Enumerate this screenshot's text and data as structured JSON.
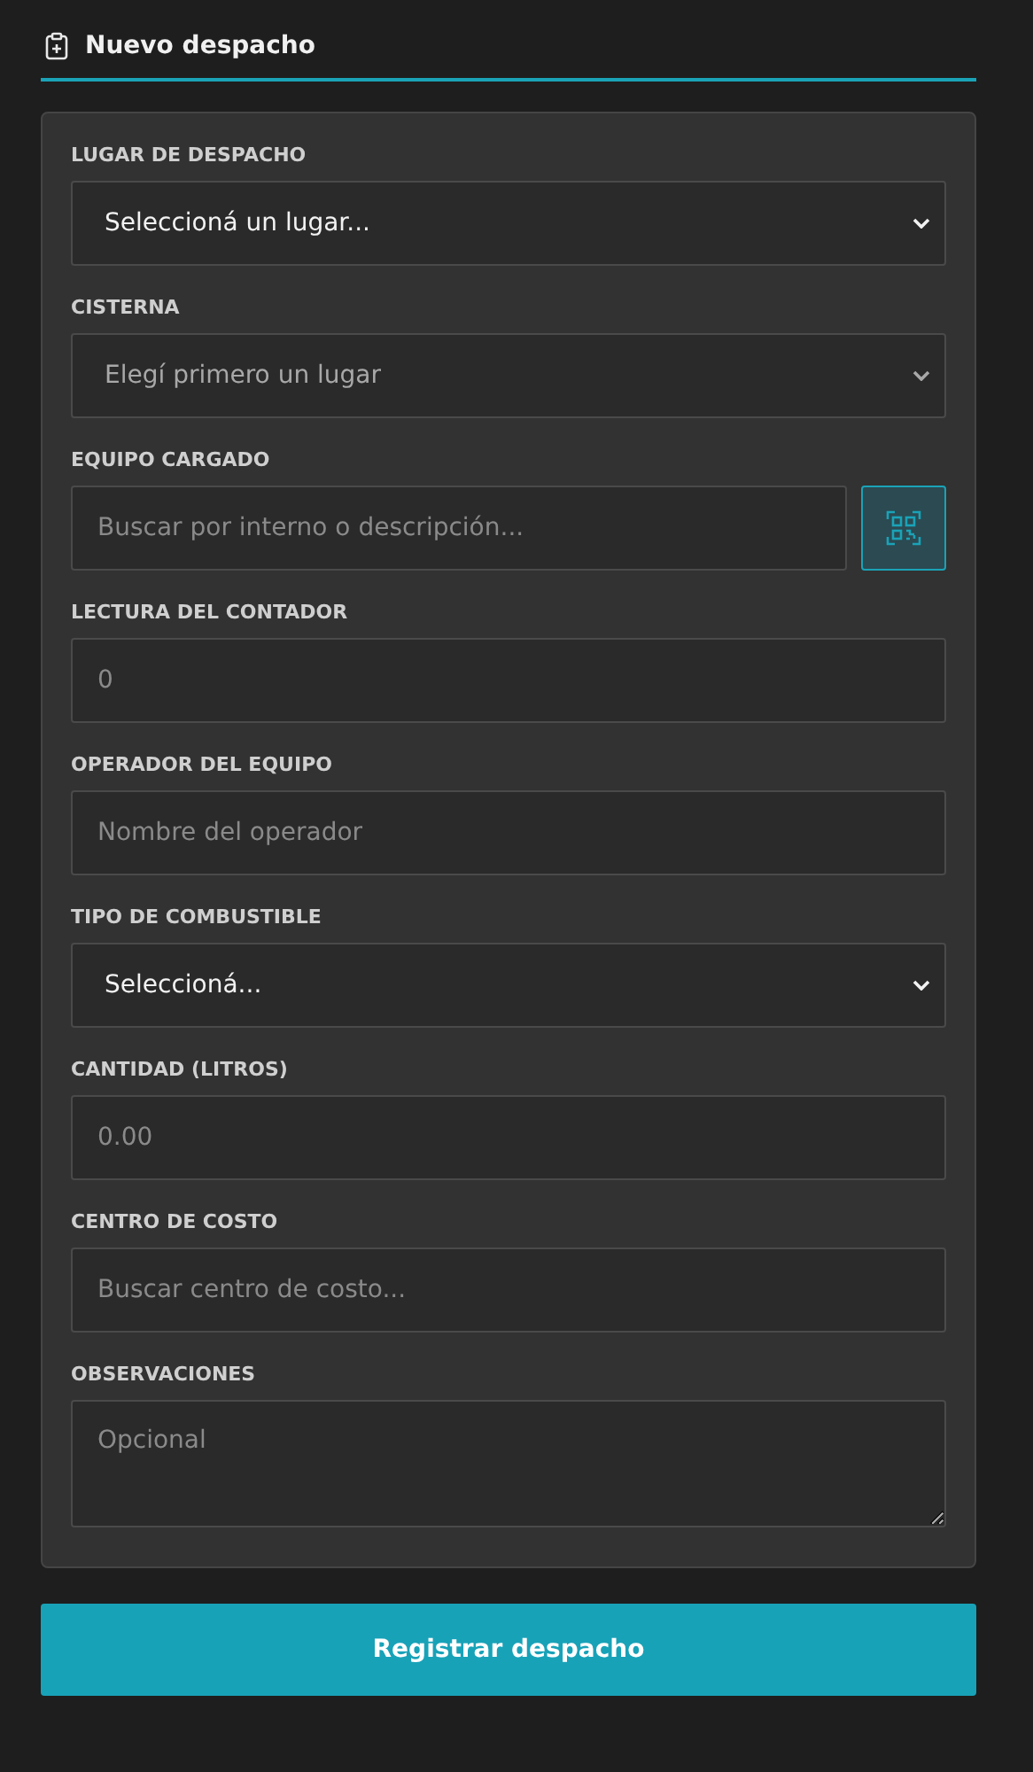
{
  "header": {
    "title": "Nuevo despacho"
  },
  "fields": [
    {
      "label": "LUGAR DE DESPACHO",
      "kind": "select",
      "value": "Seleccioná un lugar...",
      "disabled": false
    },
    {
      "label": "CISTERNA",
      "kind": "select",
      "value": "Elegí primero un lugar",
      "disabled": true
    },
    {
      "label": "EQUIPO CARGADO",
      "kind": "search",
      "placeholder": "Buscar por interno o descripción..."
    },
    {
      "label": "LECTURA DEL CONTADOR",
      "kind": "text",
      "placeholder": "0"
    },
    {
      "label": "OPERADOR DEL EQUIPO",
      "kind": "text",
      "placeholder": "Nombre del operador"
    },
    {
      "label": "TIPO DE COMBUSTIBLE",
      "kind": "select",
      "value": "Seleccioná...",
      "disabled": false
    },
    {
      "label": "CANTIDAD (LITROS)",
      "kind": "text",
      "placeholder": "0.00"
    },
    {
      "label": "CENTRO DE COSTO",
      "kind": "text",
      "placeholder": "Buscar centro de costo..."
    },
    {
      "label": "OBSERVACIONES",
      "kind": "textarea",
      "placeholder": "Opcional"
    }
  ],
  "submit": {
    "label": "Registrar despacho"
  }
}
